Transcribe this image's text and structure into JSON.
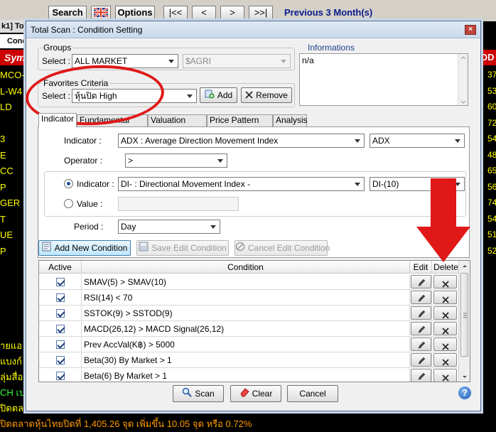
{
  "background": {
    "toolbar": {
      "search_label": "Search",
      "options_label": "Options",
      "nav_first": "|<<",
      "nav_prev": "<",
      "nav_next": ">",
      "nav_last": ">>|",
      "period_text": "Previous 3 Month(s)"
    },
    "tab_label": "k1] To",
    "cond_label": "Cond",
    "symbol_header": "Sym",
    "right_header": "OD",
    "left_rows": [
      "MCO-W",
      "L-W4",
      "LD",
      "",
      "3",
      "E",
      "CC",
      "P",
      "GER",
      "T",
      "UE",
      "P"
    ],
    "right_rows": [
      "37",
      "53",
      "60",
      "72",
      "54",
      "48",
      "65",
      "56",
      "74",
      "54",
      "51",
      "52"
    ],
    "news_lines": [
      "ายแอ",
      "แบงก์",
      "ลุ่มสื่อ",
      "CH เป",
      "ปิดตลา"
    ],
    "ticker": "ปิดตลาดหุ้นไทยปิดที่ 1,405.26 จุด เพิ่มขึ้น 10.05 จุด หรือ 0.72%"
  },
  "dialog": {
    "title": "Total Scan : Condition Setting",
    "close_symbol": "×",
    "groups": {
      "label": "Groups",
      "select_label": "Select :",
      "group_value": "ALL MARKET",
      "sub_value": "$AGRI"
    },
    "favorites": {
      "label": "Favorites Criteria",
      "select_label": "Select :",
      "value": "หุ้นปิด High",
      "add_label": "Add",
      "remove_label": "Remove"
    },
    "informations": {
      "label": "Informations",
      "text": "n/a"
    },
    "tabs": [
      "Indicator",
      "Fundamental",
      "Valuation",
      "Price Pattern",
      "Analysis"
    ],
    "indicator_panel": {
      "indicator_label": "Indicator :",
      "indicator_value": "ADX : Average Direction Movement Index",
      "indicator_short": "ADX",
      "operator_label": "Operator :",
      "operator_value": ">",
      "compare_indicator_label": "Indicator :",
      "compare_indicator_value": "DI- : Directional Movement Index -",
      "compare_indicator_short": "DI-(10)",
      "value_label": "Value :",
      "value_text": "",
      "period_label": "Period :",
      "period_value": "Day"
    },
    "actions": {
      "add_new": "Add New Condition",
      "save_edit": "Save Edit Condition",
      "cancel_edit": "Cancel Edit Condition"
    },
    "grid": {
      "headers": {
        "active": "Active",
        "condition": "Condition",
        "edit": "Edit",
        "delete": "Delete"
      },
      "rows": [
        {
          "condition": "SMAV(5) > SMAV(10)"
        },
        {
          "condition": "RSI(14) < 70"
        },
        {
          "condition": "SSTOK(9) > SSTOD(9)"
        },
        {
          "condition": "MACD(26,12) > MACD Signal(26,12)"
        },
        {
          "condition": "Prev AccVal(K฿) > 5000"
        },
        {
          "condition": "Beta(30) By Market > 1"
        },
        {
          "condition": "Beta(6) By Market > 1"
        }
      ]
    },
    "footer": {
      "scan": "Scan",
      "clear": "Clear",
      "cancel": "Cancel",
      "help_symbol": "?"
    }
  },
  "colors": {
    "annotation_red": "#e01818",
    "period_blue": "#0a1a8c",
    "ticker_orange": "#ff9900",
    "list_yellow": "#ffff00"
  }
}
